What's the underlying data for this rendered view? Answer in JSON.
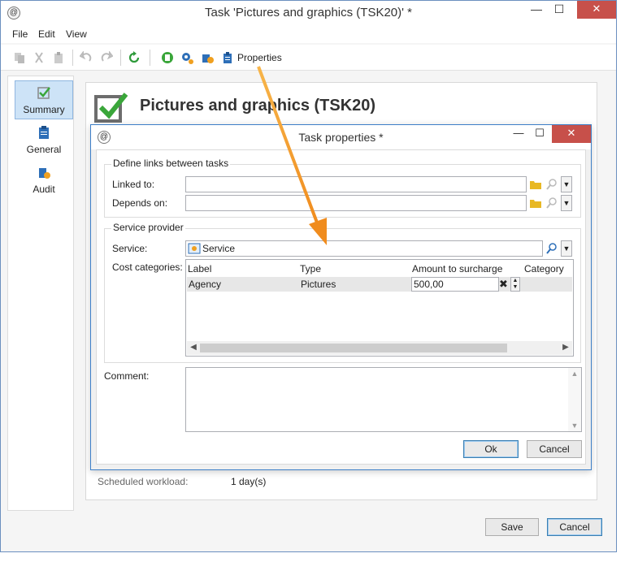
{
  "window": {
    "title": "Task 'Pictures and graphics (TSK20)' *",
    "app_icon": "@",
    "minimize": "—",
    "maximize": "☐",
    "close": "✕"
  },
  "menu": {
    "items": [
      "File",
      "Edit",
      "View"
    ]
  },
  "toolbar": {
    "properties_label": "Properties"
  },
  "sidebar": {
    "items": [
      {
        "label": "Summary",
        "active": true,
        "icon": "checkbox-icon"
      },
      {
        "label": "General",
        "icon": "clipboard-icon"
      },
      {
        "label": "Audit",
        "icon": "audit-icon"
      }
    ]
  },
  "panel": {
    "heading": "Pictures and graphics (TSK20)",
    "workload_label": "Scheduled workload:",
    "workload_value": "1 day(s)"
  },
  "dialog": {
    "title": "Task properties *",
    "links_group": {
      "legend": "Define links between tasks",
      "linked_to_label": "Linked to:",
      "linked_to_value": "",
      "depends_on_label": "Depends on:",
      "depends_on_value": ""
    },
    "provider_group": {
      "legend": "Service provider",
      "service_label": "Service:",
      "service_value": "Service",
      "cost_label": "Cost categories:",
      "columns": [
        "Label",
        "Type",
        "Amount to surcharge",
        "Category"
      ],
      "rows": [
        {
          "label": "Agency",
          "type": "Pictures",
          "amount": "500,00",
          "category": ""
        }
      ]
    },
    "comment_label": "Comment:",
    "comment_value": "",
    "ok_label": "Ok",
    "cancel_label": "Cancel"
  },
  "footer": {
    "save_label": "Save",
    "cancel_label": "Cancel"
  },
  "colors": {
    "accent": "#3d7fc8",
    "check_green": "#3aa63a",
    "annotation_arrow": "#f39a2b",
    "close_red": "#c7504a"
  }
}
